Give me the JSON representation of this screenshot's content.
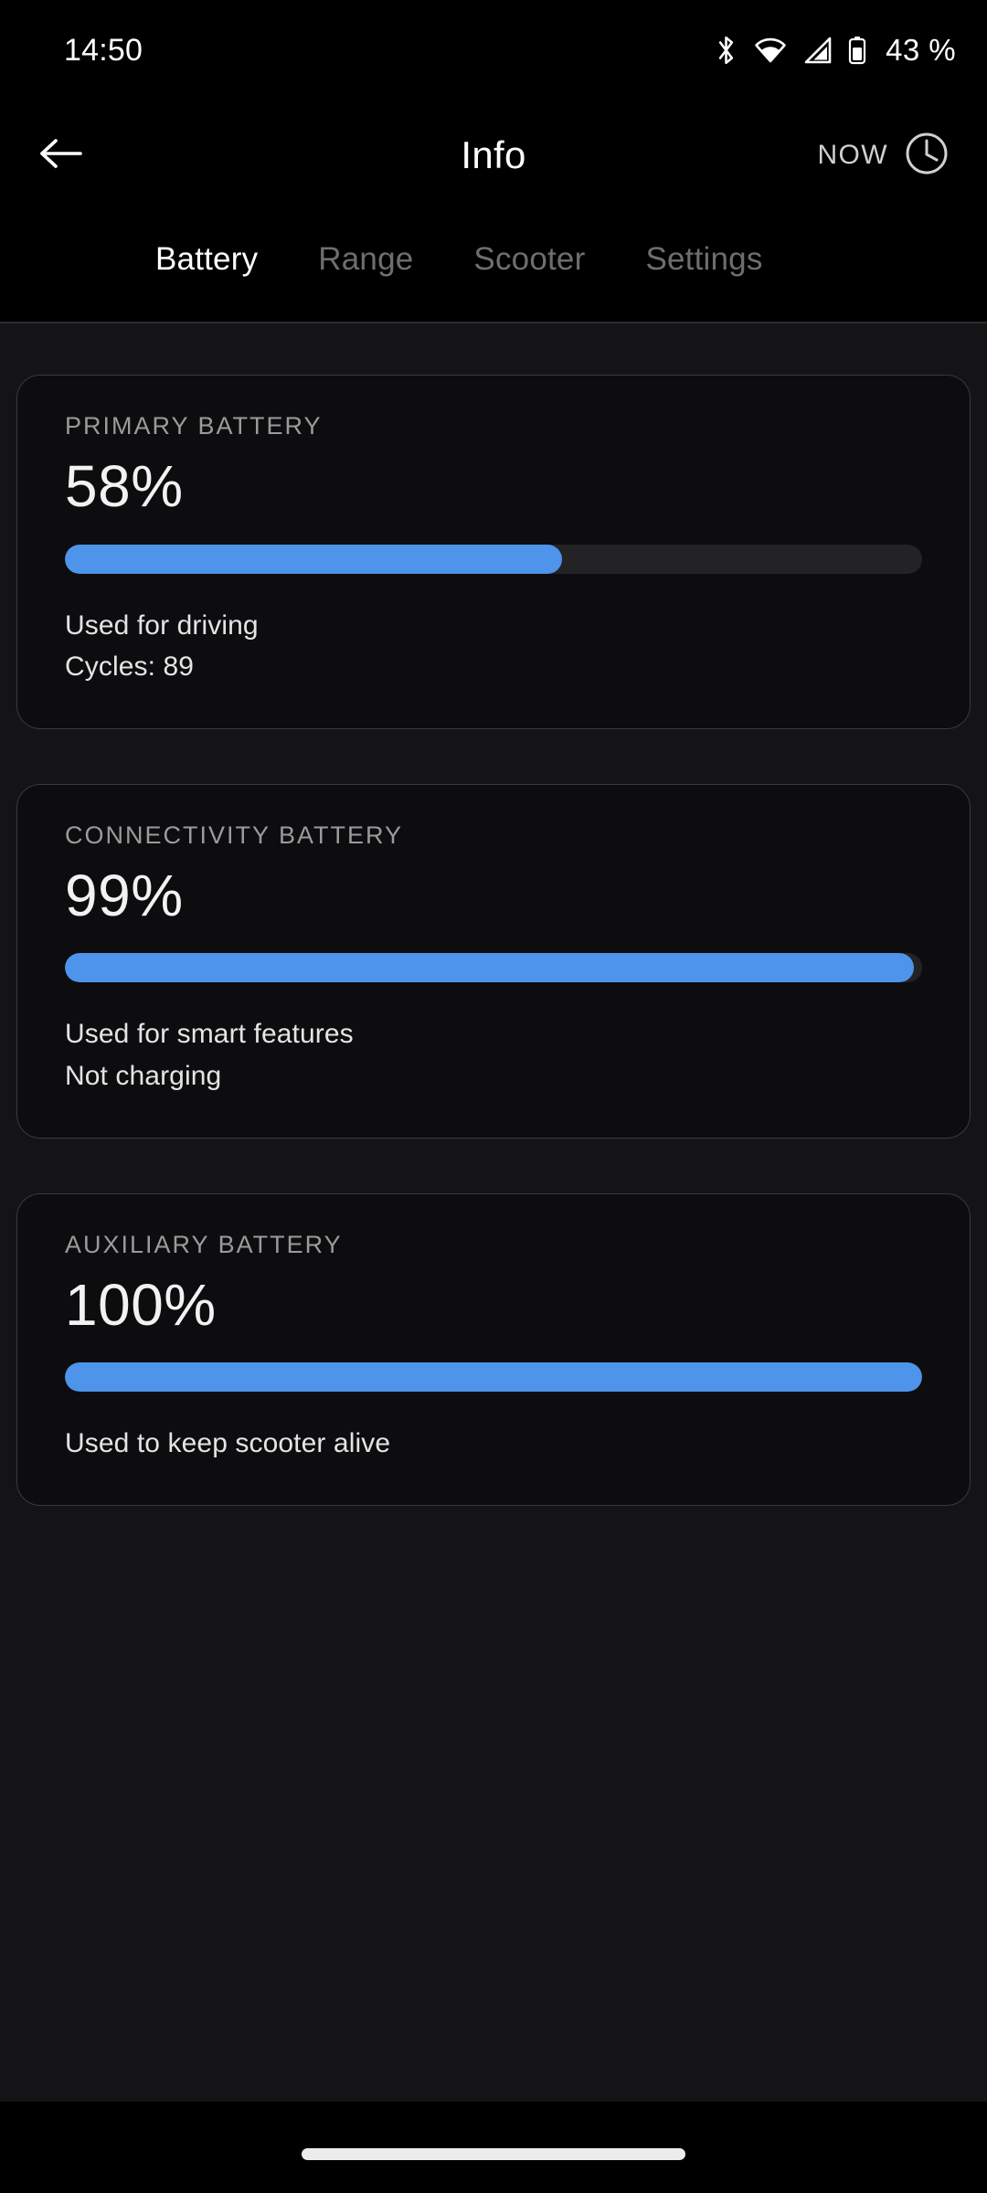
{
  "status_bar": {
    "clock": "14:50",
    "battery_percent": "43 %",
    "icons": [
      "bluetooth-icon",
      "wifi-icon",
      "cellular-signal-icon",
      "battery-icon"
    ]
  },
  "app_bar": {
    "back_icon": "back-arrow-icon",
    "title": "Info",
    "now_label": "NOW",
    "clock_icon": "clock-icon"
  },
  "tabs": [
    {
      "label": "Battery",
      "active": true
    },
    {
      "label": "Range",
      "active": false
    },
    {
      "label": "Scooter",
      "active": false
    },
    {
      "label": "Settings",
      "active": false
    }
  ],
  "colors": {
    "accent": "#4d94ea",
    "track": "#232326",
    "card_bg": "#0d0d0f",
    "card_border": "#3a3a3c",
    "page_bg": "#141417",
    "label_gray": "#9b9b9b"
  },
  "cards": [
    {
      "label": "PRIMARY BATTERY",
      "value": "58%",
      "percent": 58,
      "line1": "Used for driving",
      "line2": "Cycles: 89"
    },
    {
      "label": "CONNECTIVITY BATTERY",
      "value": "99%",
      "percent": 99,
      "line1": "Used for smart features",
      "line2": "Not charging"
    },
    {
      "label": "AUXILIARY BATTERY",
      "value": "100%",
      "percent": 100,
      "line1": "Used to keep scooter alive",
      "line2": ""
    }
  ],
  "gesture_bar": {
    "name": "home-gesture-pill"
  }
}
